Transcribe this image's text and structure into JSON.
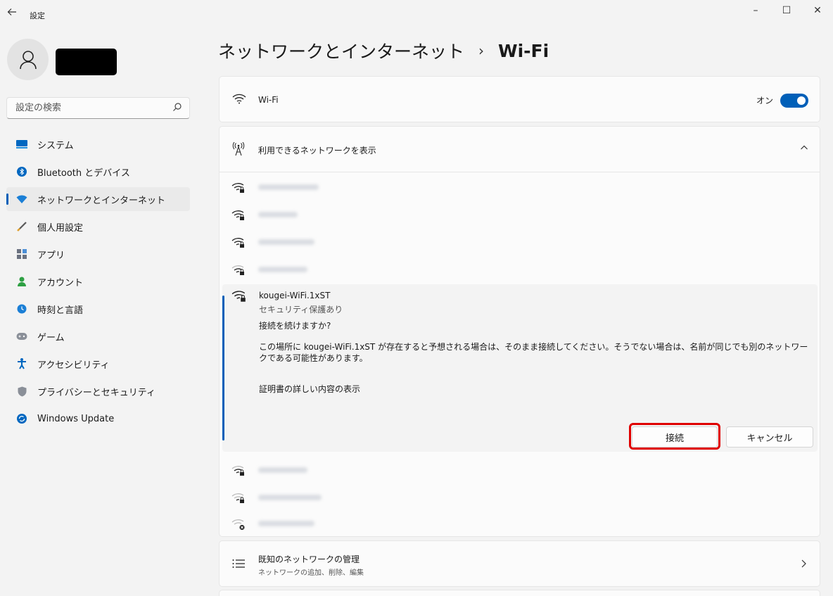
{
  "window": {
    "title": "設定",
    "back_icon": "arrow-left-icon",
    "minimize_glyph": "–",
    "maximize_glyph": "☐",
    "close_glyph": "✕"
  },
  "sidebar": {
    "search_placeholder": "設定の検索",
    "items": [
      {
        "label": "システム",
        "icon": "system-icon"
      },
      {
        "label": "Bluetooth とデバイス",
        "icon": "bluetooth-icon"
      },
      {
        "label": "ネットワークとインターネット",
        "icon": "network-icon",
        "active": true
      },
      {
        "label": "個人用設定",
        "icon": "brush-icon"
      },
      {
        "label": "アプリ",
        "icon": "apps-icon"
      },
      {
        "label": "アカウント",
        "icon": "account-icon"
      },
      {
        "label": "時刻と言語",
        "icon": "clock-globe-icon"
      },
      {
        "label": "ゲーム",
        "icon": "gamepad-icon"
      },
      {
        "label": "アクセシビリティ",
        "icon": "accessibility-icon"
      },
      {
        "label": "プライバシーとセキュリティ",
        "icon": "shield-icon"
      },
      {
        "label": "Windows Update",
        "icon": "update-icon"
      }
    ]
  },
  "breadcrumb": {
    "parent": "ネットワークとインターネット",
    "separator": "›",
    "current": "Wi-Fi"
  },
  "wifi": {
    "label": "Wi-Fi",
    "toggle_label": "オン",
    "enabled": true
  },
  "networks": {
    "header_label": "利用できるネットワークを表示",
    "expanded": {
      "ssid": "kougei-WiFi.1xST",
      "security": "セキュリティ保護あり",
      "question": "接続を続けますか?",
      "message": "この場所に kougei-WiFi.1xST が存在すると予想される場合は、そのまま接続してください。そうでない場合は、名前が同じでも別のネットワークである可能性があります。",
      "cert_link": "証明書の詳しい内容の表示",
      "connect_label": "接続",
      "cancel_label": "キャンセル"
    }
  },
  "known_networks": {
    "title": "既知のネットワークの管理",
    "subtitle": "ネットワークの追加、削除、編集"
  },
  "colors": {
    "accent": "#005fb8",
    "highlight": "#e00000",
    "background": "#f3f3f3",
    "card": "#fbfbfb"
  }
}
